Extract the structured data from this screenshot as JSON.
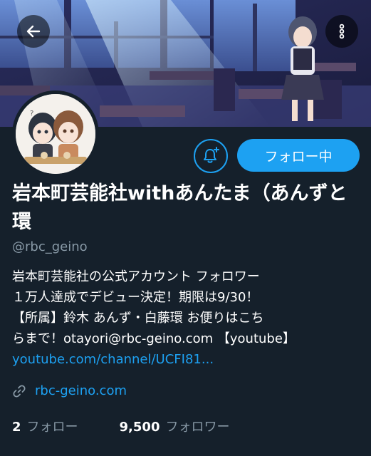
{
  "header": {
    "back_icon": "arrow-left-icon",
    "more_icon": "more-vertical-icon"
  },
  "profile": {
    "display_name": "岩本町芸能社withあんたま（あんずと環",
    "handle": "@rbc_geino",
    "bio_lines": [
      "岩本町芸能社の公式アカウント フォロワー",
      "１万人達成でデビュー決定！期限は9/30！",
      "【所属】鈴木 あんず・白藤環 お便りはこち",
      "らまで！otayori@rbc-geino.com 【youtube】"
    ],
    "bio_link": "youtube.com/channel/UCFI81...",
    "website": "rbc-geino.com",
    "website_icon": "link-icon"
  },
  "actions": {
    "notify_icon": "bell-plus-icon",
    "follow_label": "フォロー中"
  },
  "stats": {
    "following_count": "2",
    "following_label": "フォロー",
    "followers_count": "9,500",
    "followers_label": "フォロワー"
  },
  "colors": {
    "background": "#15202b",
    "accent": "#1da1f2",
    "muted": "#8899a6"
  }
}
